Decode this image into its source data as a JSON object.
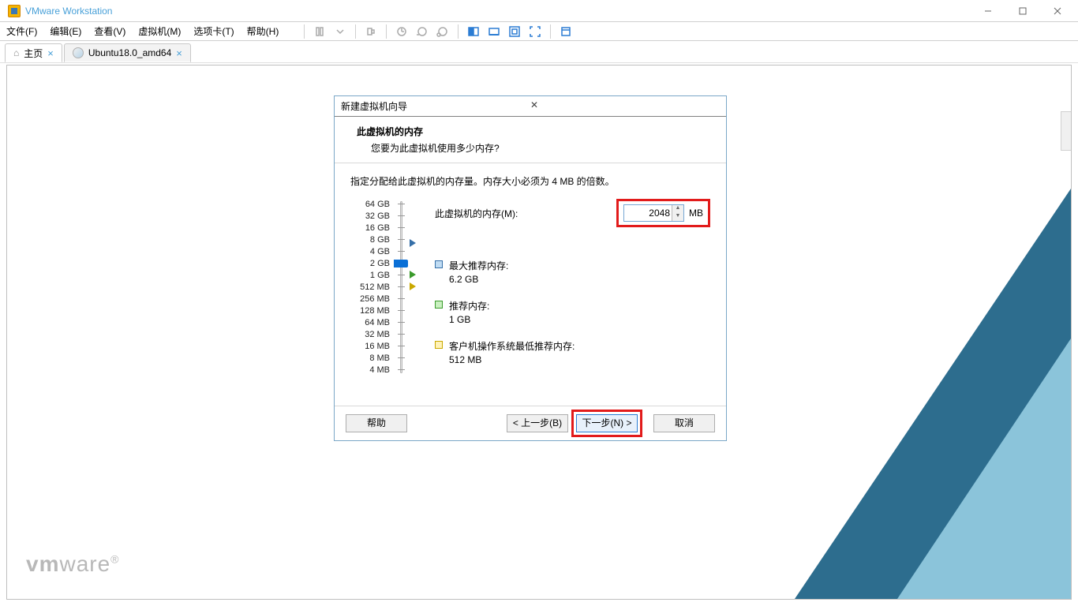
{
  "titlebar": {
    "title": "VMware Workstation"
  },
  "menu": {
    "file": "文件(F)",
    "edit": "编辑(E)",
    "view": "查看(V)",
    "vm": "虚拟机(M)",
    "tabs": "选项卡(T)",
    "help": "帮助(H)"
  },
  "tabs": {
    "home": "主页",
    "vm_tab": "Ubuntu18.0_amd64"
  },
  "logo": {
    "vm": "vm",
    "ware": "ware"
  },
  "wizard": {
    "title": "新建虚拟机向导",
    "header_title": "此虚拟机的内存",
    "header_sub": "您要为此虚拟机使用多少内存?",
    "body_desc": "指定分配给此虚拟机的内存量。内存大小必须为 4 MB 的倍数。",
    "mem_label": "此虚拟机的内存(M):",
    "mem_value": "2048",
    "mem_unit": "MB",
    "slider_labels": [
      "64 GB",
      "32 GB",
      "16 GB",
      "8 GB",
      "4 GB",
      "2 GB",
      "1 GB",
      "512 MB",
      "256 MB",
      "128 MB",
      "64 MB",
      "32 MB",
      "16 MB",
      "8 MB",
      "4 MB"
    ],
    "rec_max_label": "最大推荐内存:",
    "rec_max_val": "6.2 GB",
    "rec_label": "推荐内存:",
    "rec_val": "1 GB",
    "rec_min_label": "客户机操作系统最低推荐内存:",
    "rec_min_val": "512 MB",
    "btn_help": "帮助",
    "btn_back": "< 上一步(B)",
    "btn_next": "下一步(N) >",
    "btn_cancel": "取消"
  }
}
